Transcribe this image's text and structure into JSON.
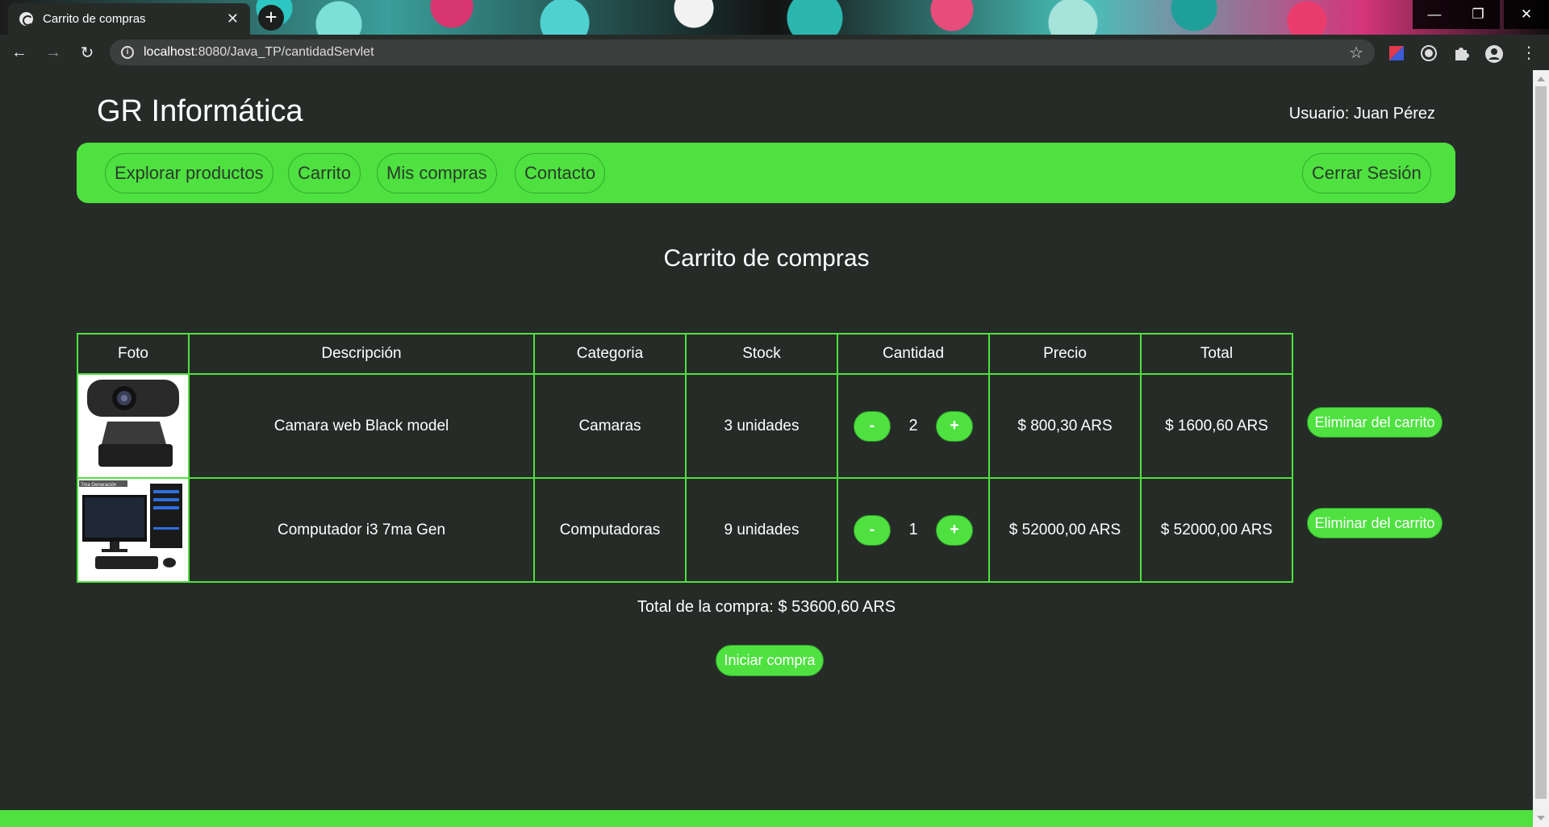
{
  "browser": {
    "tab_title": "Carrito de compras",
    "url_host": "localhost",
    "url_rest": ":8080/Java_TP/cantidadServlet"
  },
  "site": {
    "brand": "GR Informática",
    "user_label": "Usuario: Juan Pérez"
  },
  "nav": {
    "items": [
      "Explorar productos",
      "Carrito",
      "Mis compras",
      "Contacto"
    ],
    "logout": "Cerrar Sesión"
  },
  "cart": {
    "heading": "Carrito de compras",
    "columns": [
      "Foto",
      "Descripción",
      "Categoria",
      "Stock",
      "Cantidad",
      "Precio",
      "Total"
    ],
    "rows": [
      {
        "photo": "webcam-photo",
        "description": "Camara web Black model",
        "category": "Camaras",
        "stock": "3 unidades",
        "quantity": "2",
        "price": "$ 800,30 ARS",
        "total": "$ 1600,60 ARS",
        "remove_label": "Eliminar del carrito"
      },
      {
        "photo": "desktop-computer-photo",
        "photo_tag": "7ma Generación",
        "description": "Computador i3 7ma Gen",
        "category": "Computadoras",
        "stock": "9 unidades",
        "quantity": "1",
        "price": "$ 52000,00 ARS",
        "total": "$ 52000,00 ARS",
        "remove_label": "Eliminar del carrito"
      }
    ],
    "minus_label": "-",
    "plus_label": "+",
    "total_label": "Total de la compra: $ 53600,60 ARS",
    "checkout_label": "Iniciar compra"
  },
  "colors": {
    "accent": "#4ee140",
    "background": "#262b28"
  }
}
